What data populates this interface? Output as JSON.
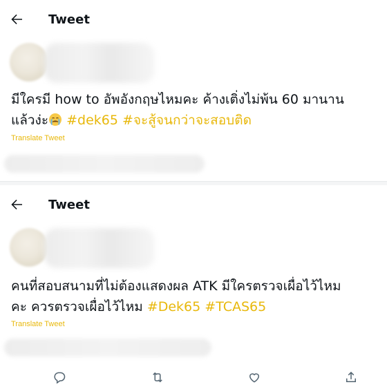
{
  "header": {
    "title": "Tweet"
  },
  "tweets": [
    {
      "text_line1": "มีใครมี how to อัพอังกฤษไหมคะ ค้างเติ่งไม่พ้น 60 มานาน",
      "text_line2_plain": "แล้วง่ะ",
      "emoji_icon": "crying-face-icon",
      "hashtag1": "#dek65",
      "hashtag2": "#จะสู้จนกว่าจะสอบติด",
      "translate_label": "Translate Tweet"
    },
    {
      "text_line1": "คนที่สอบสนามที่ไม่ต้องแสดงผล ATK มีใครตรวจเผื่อไว้ไหม",
      "text_line2_plain": "คะ ควรตรวจเผื่อไว้ไหม",
      "hashtag1": "#Dek65",
      "hashtag2": "#TCAS65",
      "translate_label": "Translate Tweet"
    }
  ],
  "action_icons": [
    "reply-icon",
    "retweet-icon",
    "like-icon",
    "share-icon"
  ],
  "colors": {
    "hashtag": "#e8b80c",
    "text": "#0f1419",
    "divider": "#f4f5f6"
  }
}
